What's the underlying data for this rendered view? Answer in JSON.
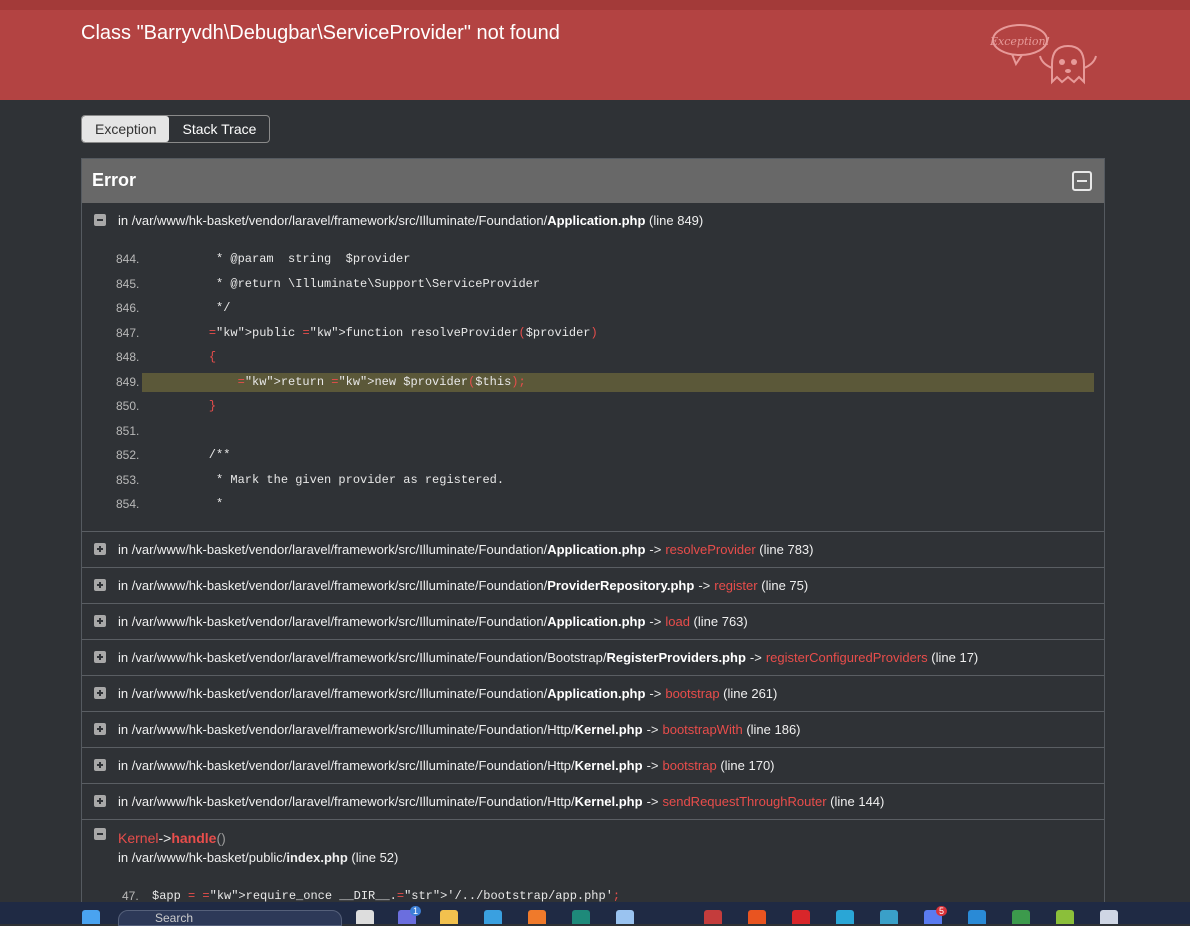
{
  "header": {
    "title": "Class \"Barryvdh\\Debugbar\\ServiceProvider\" not found",
    "ghost_bubble": "Exception!"
  },
  "tabs": [
    {
      "label": "Exception",
      "active": true
    },
    {
      "label": "Stack Trace",
      "active": false
    }
  ],
  "panel": {
    "title": "Error",
    "frame0": {
      "prefix": "in",
      "path": "/var/www/hk-basket/vendor/laravel/framework/src/Illuminate/Foundation/",
      "file": "Application.php",
      "line": "(line 849)",
      "code": [
        {
          "ln": "844.",
          "src": "     * @param  string  $provider"
        },
        {
          "ln": "845.",
          "src": "     * @return \\Illuminate\\Support\\ServiceProvider"
        },
        {
          "ln": "846.",
          "src": "     */"
        },
        {
          "ln": "847.",
          "src": "    public function resolveProvider($provider)"
        },
        {
          "ln": "848.",
          "src": "    {"
        },
        {
          "ln": "849.",
          "src": "        return new $provider($this);"
        },
        {
          "ln": "850.",
          "src": "    }"
        },
        {
          "ln": "851.",
          "src": ""
        },
        {
          "ln": "852.",
          "src": "    /**"
        },
        {
          "ln": "853.",
          "src": "     * Mark the given provider as registered."
        },
        {
          "ln": "854.",
          "src": "     *"
        }
      ]
    },
    "frames": [
      {
        "prefix": "in",
        "path": "/var/www/hk-basket/vendor/laravel/framework/src/Illuminate/Foundation/",
        "file": "Application.php",
        "arrow": "->",
        "method": "resolveProvider",
        "line": "(line 783)"
      },
      {
        "prefix": "in",
        "path": "/var/www/hk-basket/vendor/laravel/framework/src/Illuminate/Foundation/",
        "file": "ProviderRepository.php",
        "arrow": "->",
        "method": "register",
        "line": "(line 75)"
      },
      {
        "prefix": "in",
        "path": "/var/www/hk-basket/vendor/laravel/framework/src/Illuminate/Foundation/",
        "file": "Application.php",
        "arrow": "->",
        "method": "load",
        "line": "(line 763)"
      },
      {
        "prefix": "in",
        "path": "/var/www/hk-basket/vendor/laravel/framework/src/Illuminate/Foundation/Bootstrap/",
        "file": "RegisterProviders.php",
        "arrow": "->",
        "method": "registerConfiguredProviders",
        "line": "(line 17)"
      },
      {
        "prefix": "in",
        "path": "/var/www/hk-basket/vendor/laravel/framework/src/Illuminate/Foundation/",
        "file": "Application.php",
        "arrow": "->",
        "method": "bootstrap",
        "line": "(line 261)"
      },
      {
        "prefix": "in",
        "path": "/var/www/hk-basket/vendor/laravel/framework/src/Illuminate/Foundation/Http/",
        "file": "Kernel.php",
        "arrow": "->",
        "method": "bootstrapWith",
        "line": "(line 186)"
      },
      {
        "prefix": "in",
        "path": "/var/www/hk-basket/vendor/laravel/framework/src/Illuminate/Foundation/Http/",
        "file": "Kernel.php",
        "arrow": "->",
        "method": "bootstrap",
        "line": "(line 170)"
      },
      {
        "prefix": "in",
        "path": "/var/www/hk-basket/vendor/laravel/framework/src/Illuminate/Foundation/Http/",
        "file": "Kernel.php",
        "arrow": "->",
        "method": "sendRequestThroughRouter",
        "line": "(line 144)"
      }
    ],
    "last_frame": {
      "class": "Kernel",
      "arrow": "->",
      "method": "handle",
      "parens": "()",
      "prefix": "in",
      "path": "/var/www/hk-basket/public/",
      "file": "index.php",
      "line": "(line 52)",
      "code": {
        "ln": "47.",
        "src": "$app = require_once __DIR__.'/../bootstrap/app.php';"
      }
    }
  },
  "taskbar": {
    "search_placeholder": "Search",
    "badges": [
      "1",
      "5"
    ]
  },
  "colors": {
    "header": "#b34342",
    "accent_method": "#e84d4b",
    "highlight_line": "#5b5839"
  }
}
